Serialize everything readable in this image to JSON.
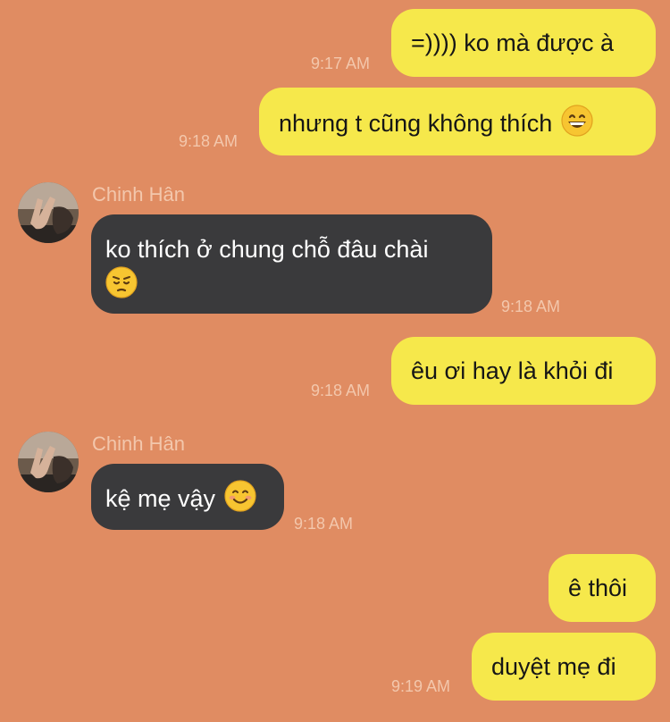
{
  "colors": {
    "background": "#E08C62",
    "outgoing_bubble": "#F6E84B",
    "incoming_bubble": "#3A3A3C",
    "meta_text": "#F3C7AC"
  },
  "messages": [
    {
      "direction": "outgoing",
      "text": "=)))) ko mà được à",
      "time": "9:17 AM"
    },
    {
      "direction": "outgoing",
      "text": "nhưng t cũng không thích",
      "emoji": "grinning-face",
      "time": "9:18 AM"
    },
    {
      "direction": "incoming",
      "sender": "Chinh Hân",
      "text": "ko thích ở chung chỗ đâu chài",
      "emoji": "pensive-face",
      "time": "9:18 AM"
    },
    {
      "direction": "outgoing",
      "text": "êu ơi hay là khỏi đi",
      "time": "9:18 AM"
    },
    {
      "direction": "incoming",
      "sender": "Chinh Hân",
      "text": "kệ mẹ vậy",
      "emoji": "smiling-face",
      "time": "9:18 AM"
    },
    {
      "direction": "outgoing",
      "text": "ê thôi"
    },
    {
      "direction": "outgoing",
      "text": "duyệt mẹ đi",
      "time": "9:19 AM"
    }
  ]
}
